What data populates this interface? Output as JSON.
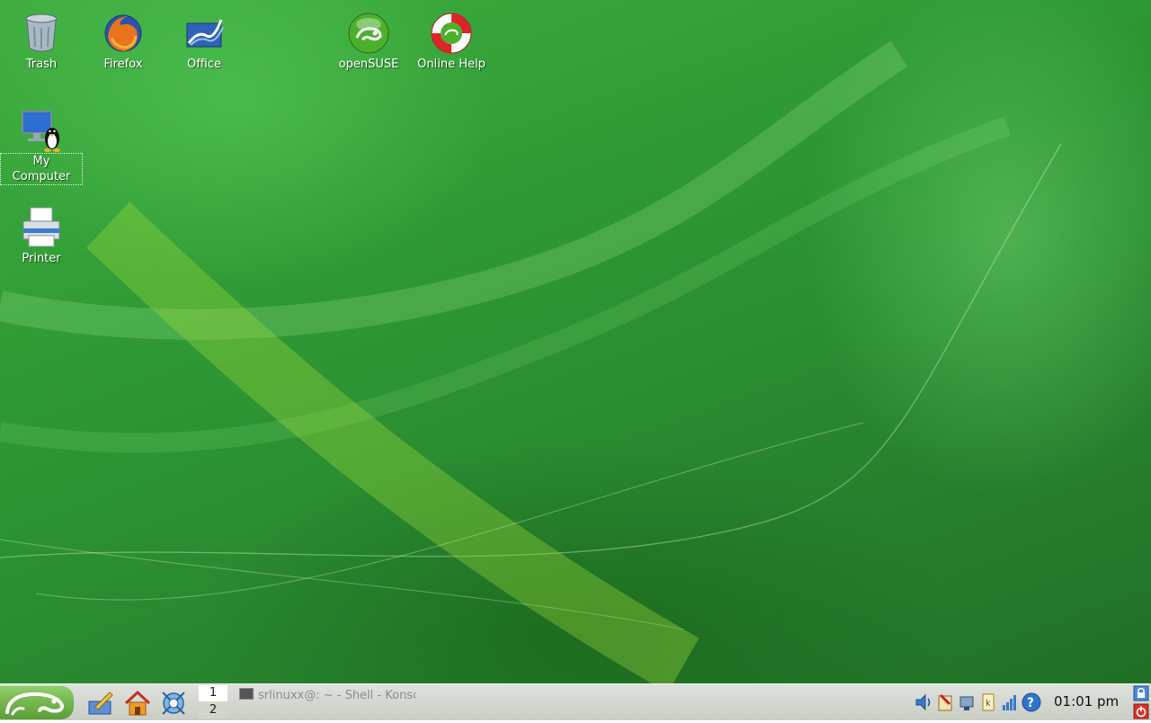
{
  "desktop": {
    "icons": [
      {
        "label": "Trash"
      },
      {
        "label": "Firefox"
      },
      {
        "label": "Office"
      },
      {
        "label": "openSUSE"
      },
      {
        "label": "Online Help"
      },
      {
        "label": "My Computer"
      },
      {
        "label": "Printer"
      }
    ]
  },
  "taskbar": {
    "pager": [
      "1",
      "2"
    ],
    "task": "srlinuxx@: ~ - Shell - Konsole",
    "clock": "01:01 pm"
  },
  "colors": {
    "wallpaper": "#2f9a35",
    "taskbar": "#d6d9d2",
    "accent_green": "#5a9d37"
  }
}
